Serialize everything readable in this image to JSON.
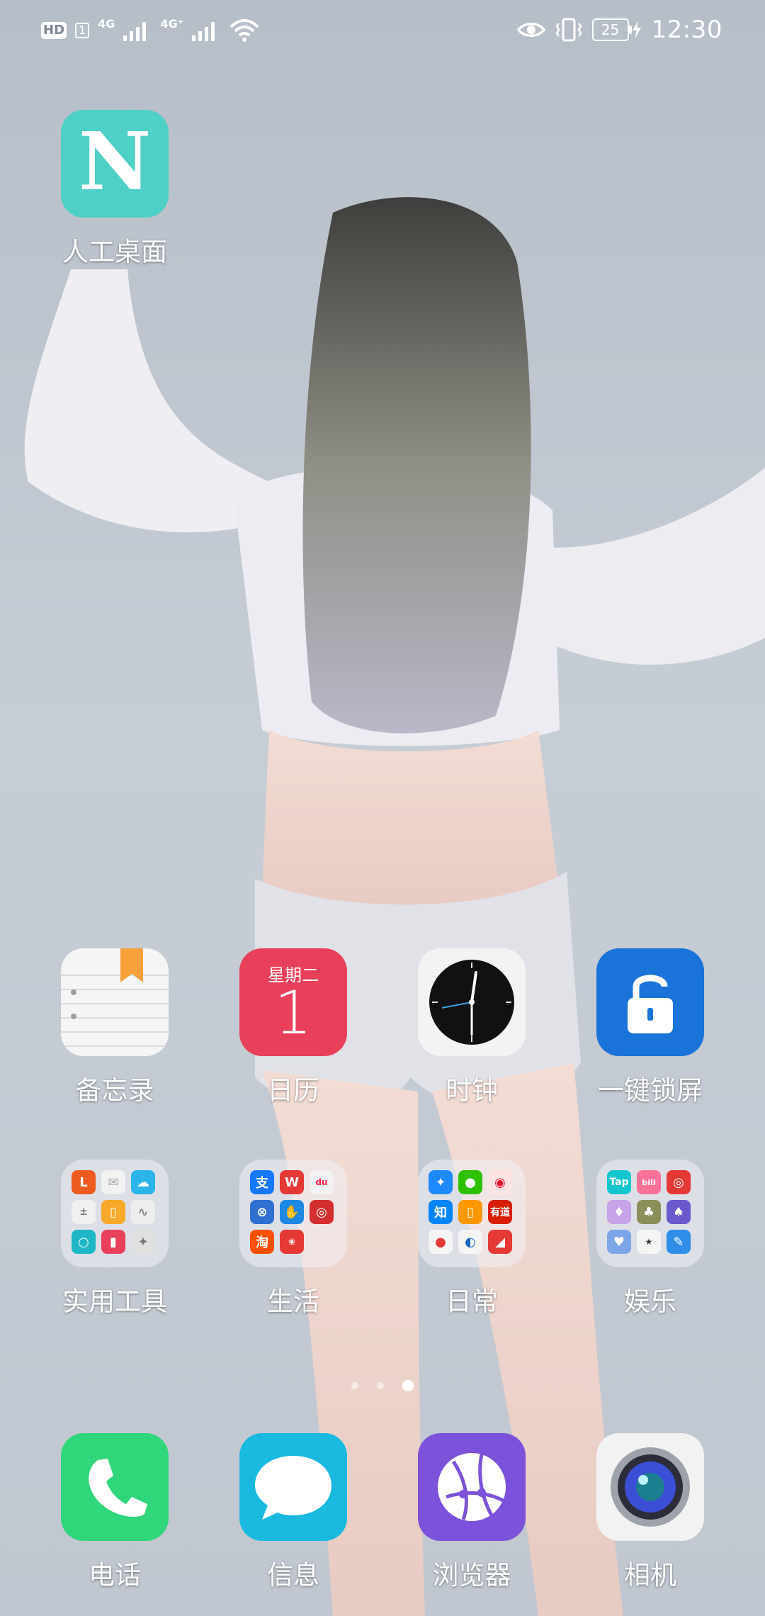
{
  "status_bar": {
    "hd": "HD",
    "sim": "1",
    "net1": "4G",
    "net2": "4G⁺",
    "battery_level": "25",
    "time": "12:30"
  },
  "top_app": {
    "label": "人工桌面",
    "icon_letter": "N",
    "color": "#4fd0c6"
  },
  "row1": [
    {
      "label": "备忘录",
      "icon": "notepad-icon"
    },
    {
      "label": "日历",
      "icon": "calendar-icon",
      "weekday": "星期二",
      "day": "1"
    },
    {
      "label": "时钟",
      "icon": "clock-icon"
    },
    {
      "label": "一键锁屏",
      "icon": "padlock-icon"
    }
  ],
  "folders": [
    {
      "label": "实用工具"
    },
    {
      "label": "生活"
    },
    {
      "label": "日常"
    },
    {
      "label": "娱乐"
    }
  ],
  "pager": {
    "count": 3,
    "active": 3
  },
  "dock": [
    {
      "label": "电话",
      "icon": "phone-icon"
    },
    {
      "label": "信息",
      "icon": "message-icon"
    },
    {
      "label": "浏览器",
      "icon": "browser-icon"
    },
    {
      "label": "相机",
      "icon": "camera-icon"
    }
  ],
  "colors": {
    "phone": "#2fd67a",
    "message": "#19b9e0",
    "browser": "#7b52d9",
    "lock": "#1a73d8",
    "calendar": "#e8405b"
  }
}
